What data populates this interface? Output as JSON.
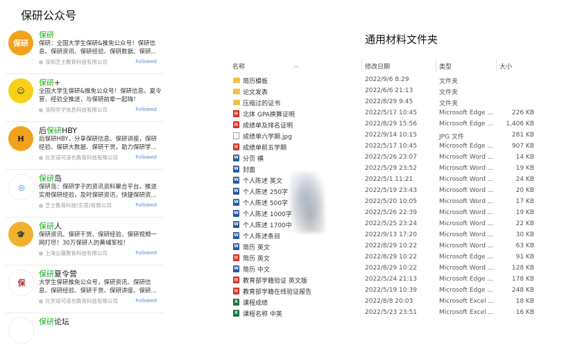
{
  "left_title": "保研公众号",
  "accounts": [
    {
      "avatar_text": "保研",
      "avatar_bg": "#f2a21b",
      "avatar_color": "#ffffff",
      "name_hl": "保研",
      "name_rest": "",
      "desc": "保研：全国大学生保研&推免公众号！保研信息、保研资讯、保研经验、保研数据、保研...",
      "org": "深圳芝士教育科技有限公司",
      "follow": "Followed"
    },
    {
      "avatar_text": "☺",
      "avatar_bg": "#f7d117",
      "avatar_color": "#333333",
      "name_hl": "保研",
      "name_rest": "+",
      "desc": "全国大学生保研&推免公众号！保研信息、夏令营、经验全推送，与保研前辈一起嗨！",
      "org": "洛阳学子信息科技有限公司",
      "follow": "Followed"
    },
    {
      "avatar_text": "H",
      "avatar_bg": "#f2a21b",
      "avatar_color": "#222222",
      "name_pre": "后",
      "name_hl": "保研",
      "name_rest": "HBY",
      "desc": "后保研HBY，分享保研信息、保研讲座，保研经验、保研大数据、保研干货，助力保研学...",
      "org": "北京道可道也教育科技有限公司",
      "follow": "Followed"
    },
    {
      "avatar_text": "◎",
      "avatar_bg": "#ffffff",
      "avatar_color": "#2f7fd1",
      "name_hl": "保研",
      "name_rest": "岛",
      "desc": "保研岛：保研学子的资讯资料聚合平台。推送实用保研经验，及时保研资讯，快捷保研资...",
      "org": "芝士教育科技(东莞)有限公司",
      "follow": "Followed"
    },
    {
      "avatar_text": "🎓",
      "avatar_bg": "#f2b12a",
      "avatar_color": "#ffffff",
      "name_hl": "保研",
      "name_rest": "人",
      "desc": "保研资讯、保研干货、保研经验、保研视频一网打尽！30万保研人的黄埔军校！",
      "org": "上海云辗教育科技有限公司",
      "follow": "Followed"
    },
    {
      "avatar_text": "保",
      "avatar_bg": "#ffffff",
      "avatar_color": "#c0282d",
      "name_hl": "保研",
      "name_rest": "夏令营",
      "desc": "大学生保研推免公众号，保研资讯、保研信息、保研经验、保研干货、保研讲座、保研...",
      "org": "北京道可道也教育科技有限公司",
      "follow": "Followed"
    },
    {
      "avatar_text": "",
      "avatar_bg": "#ffffff",
      "avatar_color": "#c0282d",
      "name_hl": "保研",
      "name_rest": "论坛",
      "desc": "",
      "org": "",
      "follow": ""
    }
  ],
  "right_title": "通用材料文件夹",
  "columns": {
    "name": "名称",
    "date": "修改日期",
    "type": "类型",
    "size": "大小"
  },
  "files": [
    {
      "icon": "folder",
      "name": "简历模板",
      "date": "2022/9/6 8:29",
      "type": "文件夹",
      "size": ""
    },
    {
      "icon": "folder",
      "name": "论文发表",
      "date": "2022/6/6 21:13",
      "type": "文件夹",
      "size": ""
    },
    {
      "icon": "folder",
      "name": "压缩过的证书",
      "date": "2022/8/29 9:45",
      "type": "文件夹",
      "size": ""
    },
    {
      "icon": "pdf",
      "name": "北体 GPA换算证明",
      "date": "2022/5/17 10:45",
      "type": "Microsoft Edge ...",
      "size": "226 KB"
    },
    {
      "icon": "pdf",
      "name": "成绩单及排名证明",
      "date": "2022/8/29 15:56",
      "type": "Microsoft Edge ...",
      "size": "1,406 KB"
    },
    {
      "icon": "jpg",
      "name": "成绩单六学期.jpg",
      "date": "2022/9/14 10:15",
      "type": "JPG 文件",
      "size": "281 KB"
    },
    {
      "icon": "pdf",
      "name": "成绩单前五学期",
      "date": "2022/5/17 10:45",
      "type": "Microsoft Edge ...",
      "size": "907 KB"
    },
    {
      "icon": "word",
      "name": "分页 横",
      "date": "2022/5/26 23:07",
      "type": "Microsoft Word ...",
      "size": "14 KB"
    },
    {
      "icon": "word",
      "name": "封面",
      "date": "2022/5/29 23:52",
      "type": "Microsoft Word ...",
      "size": "19 KB"
    },
    {
      "icon": "word",
      "name": "个人陈述 英文",
      "date": "2022/5/1 11:21",
      "type": "Microsoft Word ...",
      "size": "24 KB"
    },
    {
      "icon": "word",
      "name": "个人陈述 250字",
      "date": "2022/5/19 23:43",
      "type": "Microsoft Word ...",
      "size": "20 KB"
    },
    {
      "icon": "word",
      "name": "个人陈述 500字",
      "date": "2022/5/20 10:05",
      "type": "Microsoft Word ...",
      "size": "17 KB"
    },
    {
      "icon": "word",
      "name": "个人陈述 1000字",
      "date": "2022/5/26 22:39",
      "type": "Microsoft Word ...",
      "size": "19 KB"
    },
    {
      "icon": "word",
      "name": "个人陈述 1700中",
      "date": "2022/5/25 23:24",
      "type": "Microsoft Word ...",
      "size": "22 KB"
    },
    {
      "icon": "word",
      "name": "个人陈述条目",
      "date": "2022/9/13 17:20",
      "type": "Microsoft Word ...",
      "size": "30 KB"
    },
    {
      "icon": "word",
      "name": "简历 英文",
      "date": "2022/8/29 10:22",
      "type": "Microsoft Word ...",
      "size": "63 KB"
    },
    {
      "icon": "pdf",
      "name": "简历 英文",
      "date": "2022/8/29 10:22",
      "type": "Microsoft Edge ...",
      "size": "91 KB"
    },
    {
      "icon": "word",
      "name": "简历 中文",
      "date": "2022/8/29 10:22",
      "type": "Microsoft Word ...",
      "size": "128 KB"
    },
    {
      "icon": "pdf",
      "name": "教育部学籍验证 英文版",
      "date": "2022/5/24 21:13",
      "type": "Microsoft Edge ...",
      "size": "178 KB"
    },
    {
      "icon": "pdf",
      "name": "教育部学籍在线验证报告",
      "date": "2022/5/19 10:39",
      "type": "Microsoft Edge ...",
      "size": "248 KB"
    },
    {
      "icon": "excel",
      "name": "课程成绩",
      "date": "2022/8/8 20:03",
      "type": "Microsoft Excel ...",
      "size": "18 KB"
    },
    {
      "icon": "excel",
      "name": "课程名称 中英",
      "date": "2022/5/23 23:51",
      "type": "Microsoft Excel ...",
      "size": "16 KB"
    }
  ]
}
